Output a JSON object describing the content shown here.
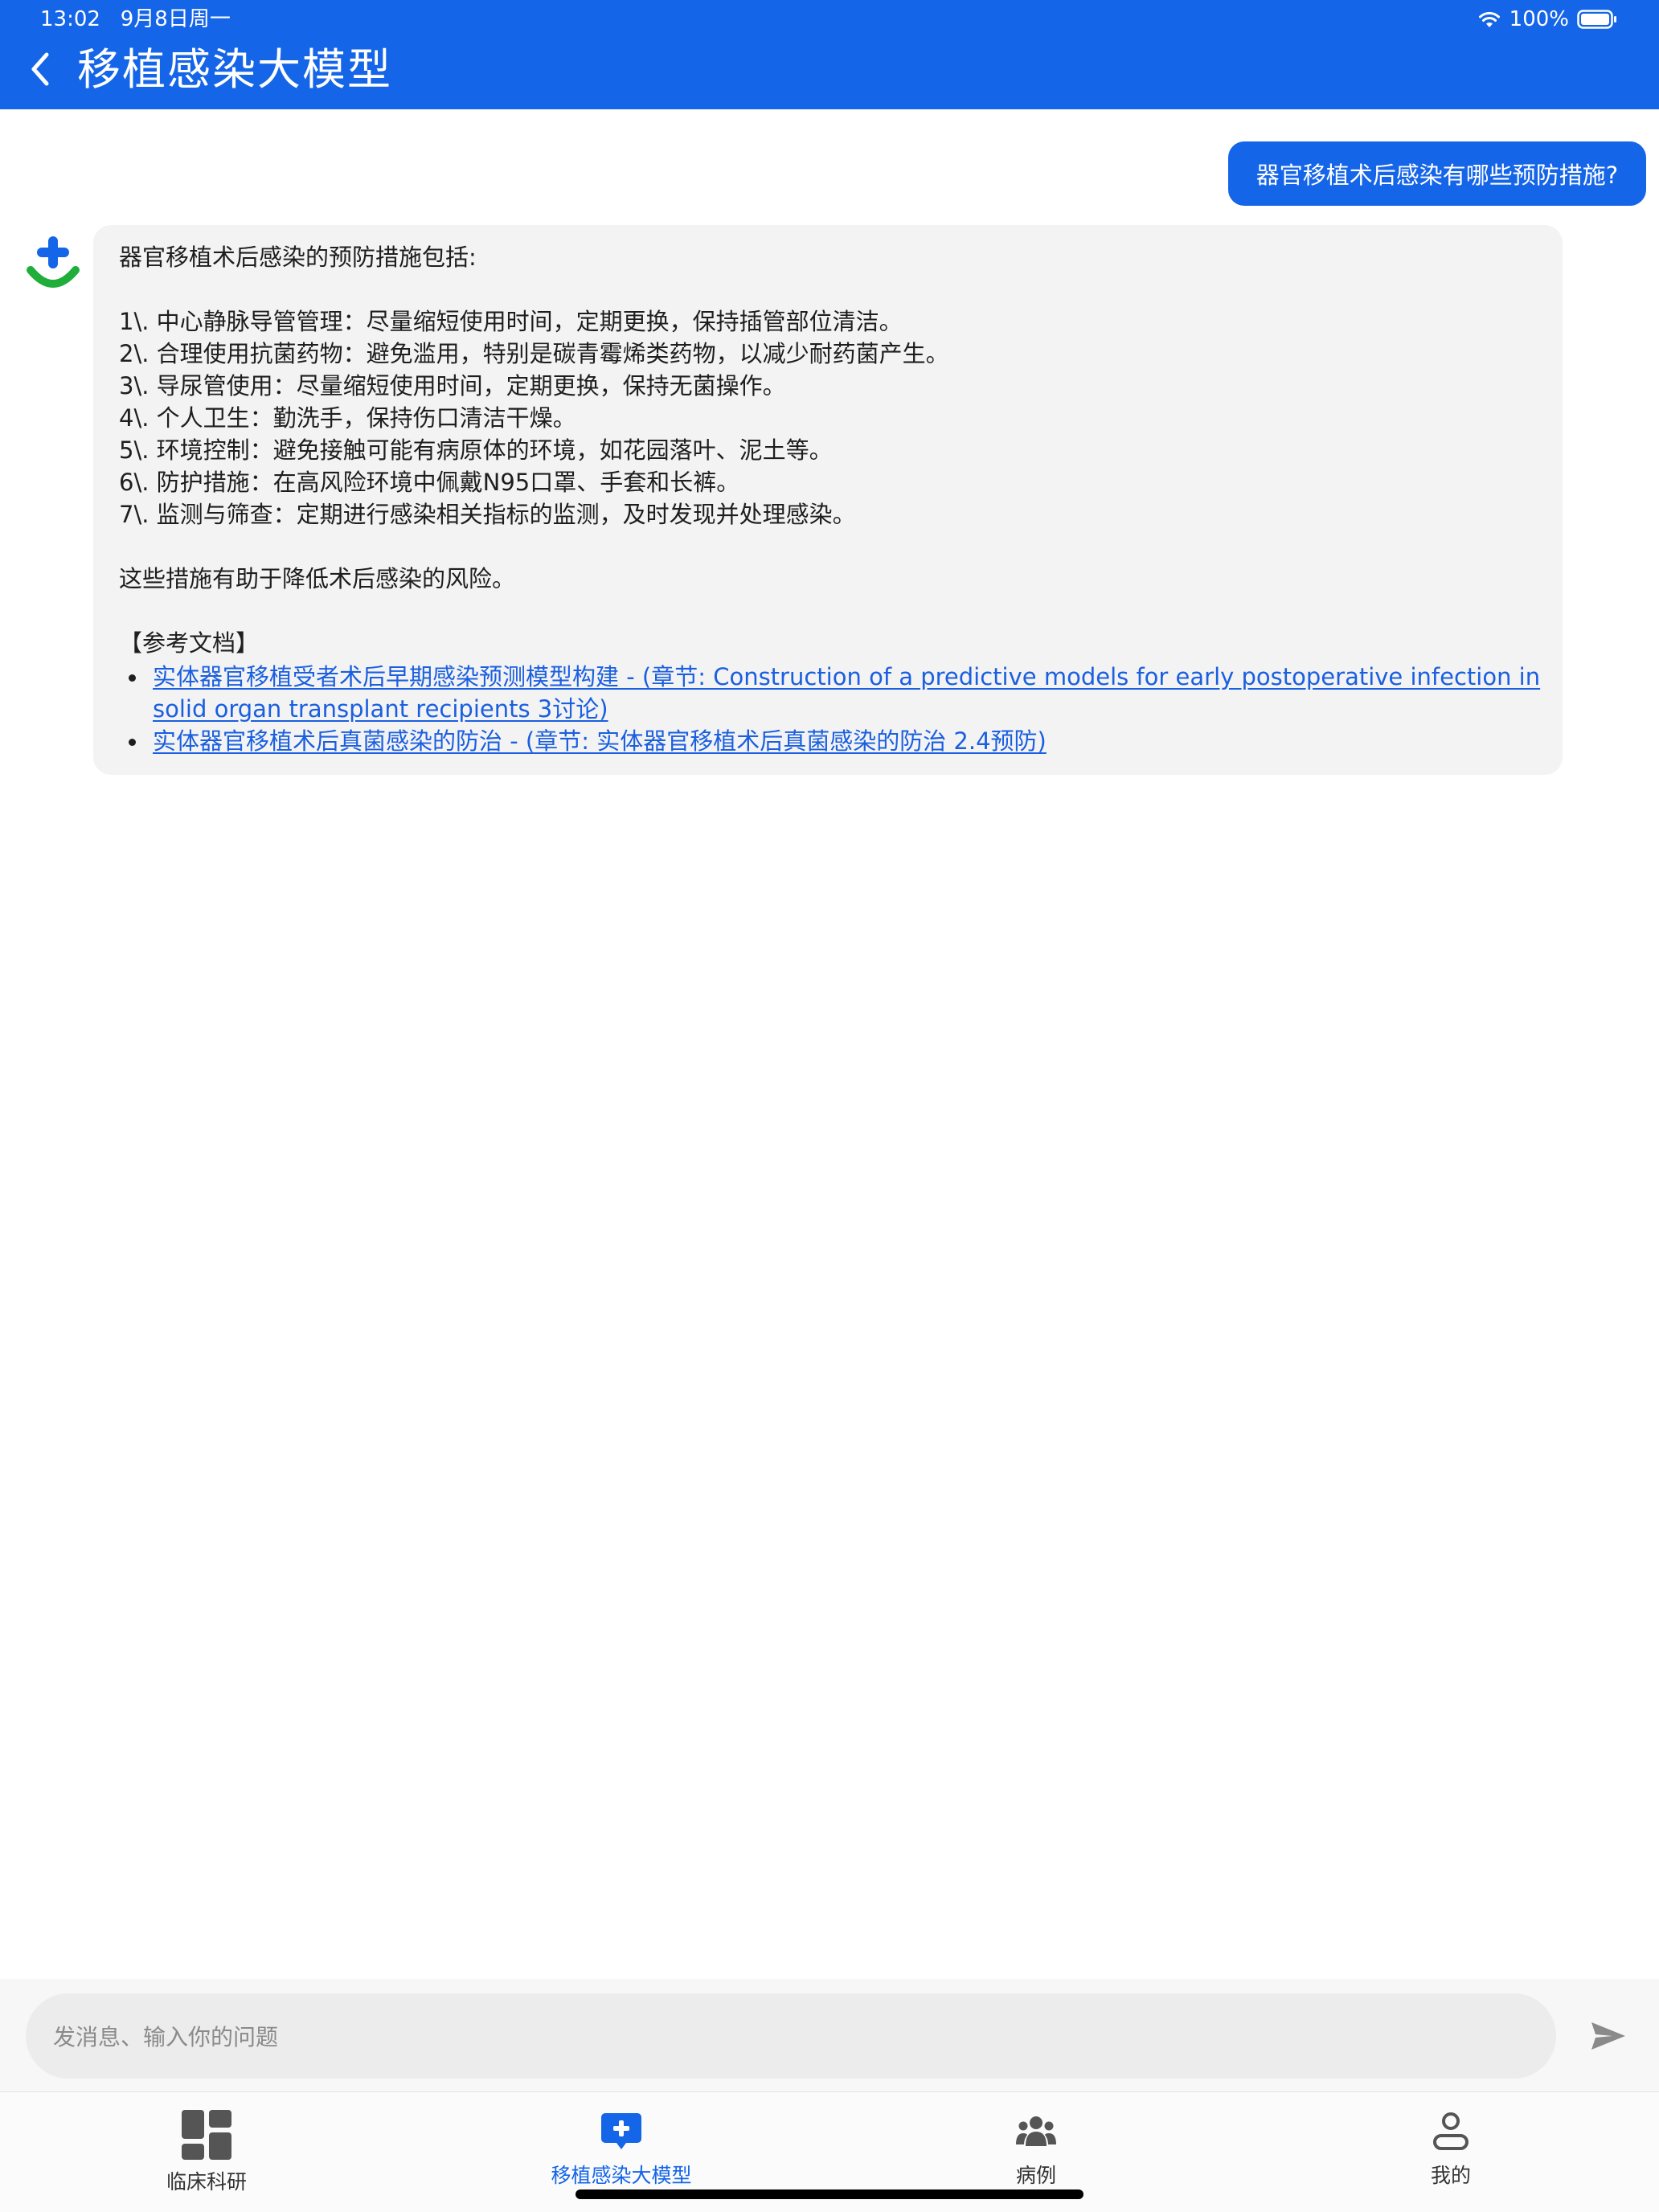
{
  "status_bar": {
    "time": "13:02",
    "date": "9月8日周一",
    "battery": "100%"
  },
  "nav": {
    "title": "移植感染大模型"
  },
  "chat": {
    "user_message": "器官移植术后感染有哪些预防措施?",
    "bot": {
      "intro": "器官移植术后感染的预防措施包括:",
      "items": [
        "1\\. 中心静脉导管管理：尽量缩短使用时间，定期更换，保持插管部位清洁。",
        "2\\. 合理使用抗菌药物：避免滥用，特别是碳青霉烯类药物，以减少耐药菌产生。",
        "3\\. 导尿管使用：尽量缩短使用时间，定期更换，保持无菌操作。",
        "4\\. 个人卫生：勤洗手，保持伤口清洁干燥。",
        "5\\. 环境控制：避免接触可能有病原体的环境，如花园落叶、泥土等。",
        "6\\. 防护措施：在高风险环境中佩戴N95口罩、手套和长裤。",
        "7\\. 监测与筛查：定期进行感染相关指标的监测，及时发现并处理感染。"
      ],
      "summary": "这些措施有助于降低术后感染的风险。",
      "ref_heading": "【参考文档】",
      "references": [
        {
          "line1": "实体器官移植受者术后早期感染预测模型构建 - (章节: Construction of a predictive models for early postoperative infection in",
          "line2": "solid organ transplant recipients 3讨论)"
        },
        {
          "line1": "实体器官移植术后真菌感染的防治 - (章节: 实体器官移植术后真菌感染的防治 2.4预防)"
        }
      ]
    }
  },
  "input": {
    "placeholder": "发消息、输入你的问题"
  },
  "tabs": [
    {
      "label": "临床科研",
      "icon": "dashboard-icon"
    },
    {
      "label": "移植感染大模型",
      "icon": "medical-chat-icon",
      "active": true
    },
    {
      "label": "病例",
      "icon": "group-icon"
    },
    {
      "label": "我的",
      "icon": "person-icon"
    }
  ],
  "colors": {
    "primary": "#1565e8",
    "avatar_green": "#1fae3a",
    "link": "#1a5fe0"
  }
}
